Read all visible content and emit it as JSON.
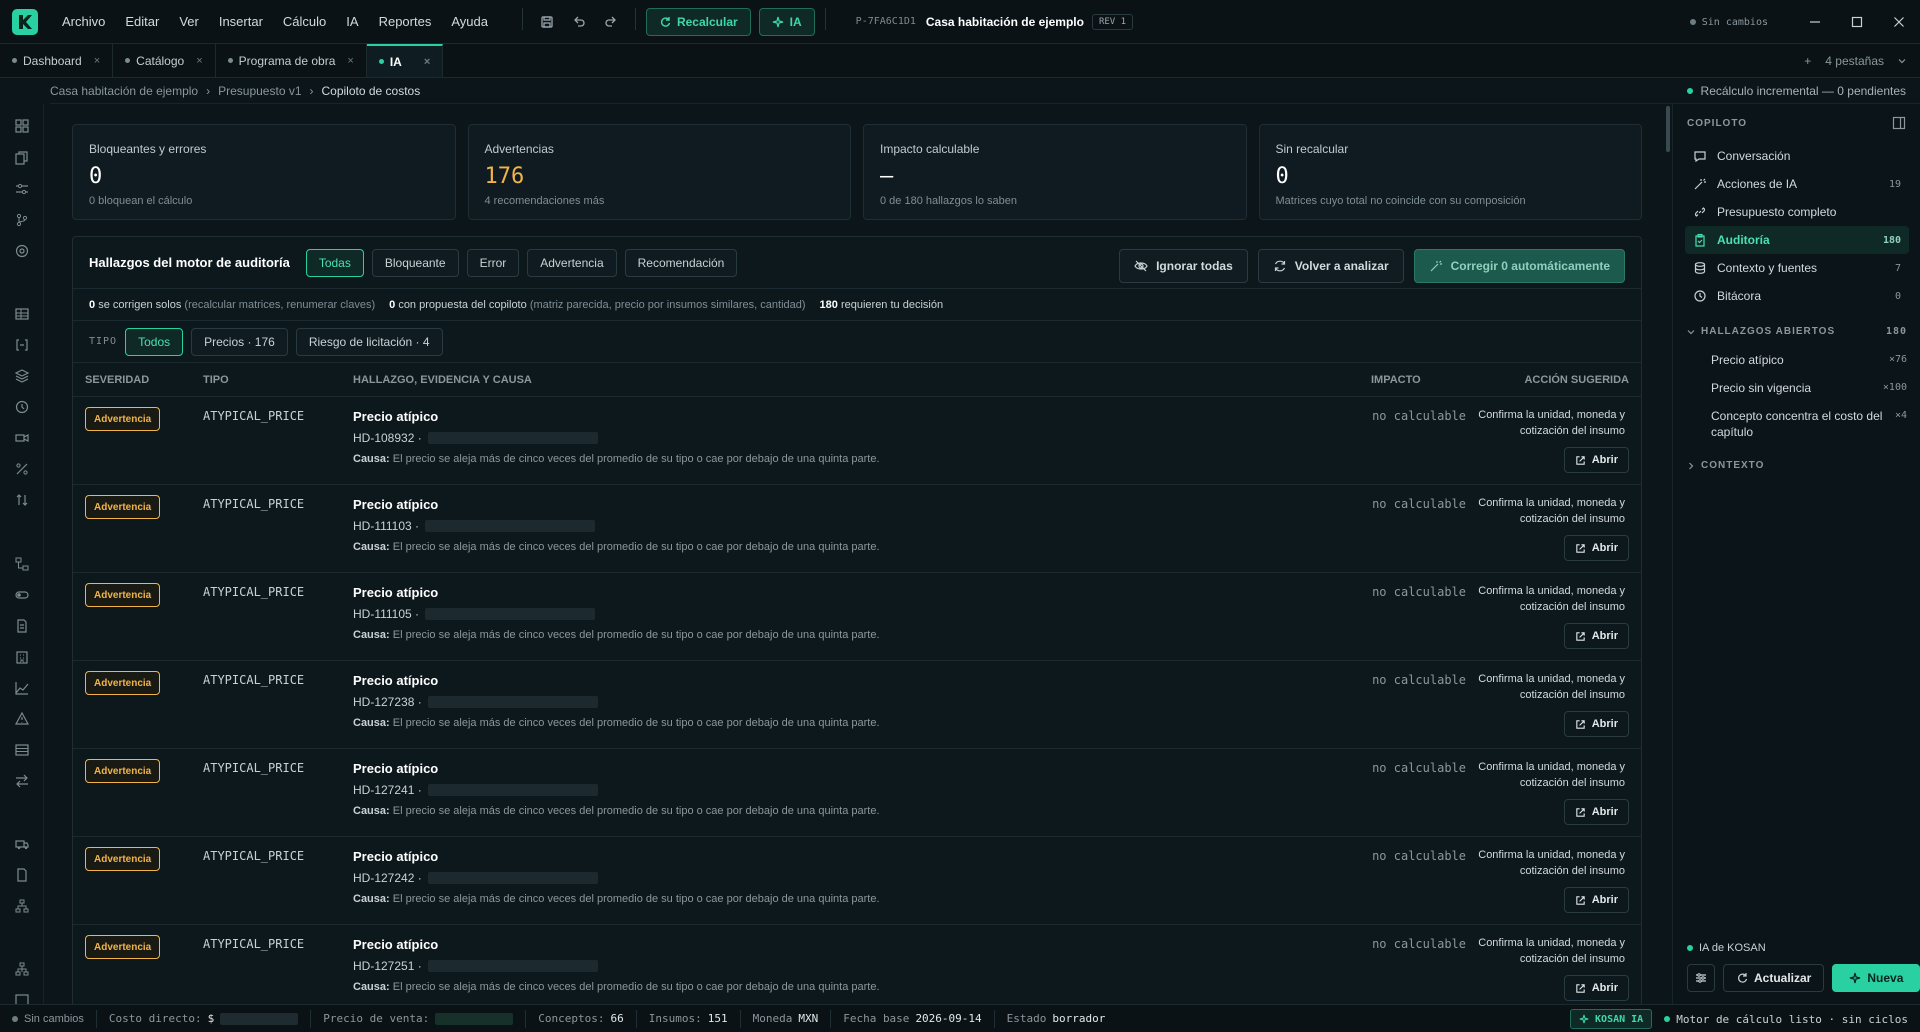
{
  "app": {
    "menu": [
      "Archivo",
      "Editar",
      "Ver",
      "Insertar",
      "Cálculo",
      "IA",
      "Reportes",
      "Ayuda"
    ],
    "recalc_label": "Recalcular",
    "ia_label": "IA",
    "doc_id": "P-7FA6C1D1",
    "doc_title": "Casa habitación de ejemplo",
    "rev": "REV 1",
    "save_state": "Sin cambios"
  },
  "tabs": [
    {
      "label": "Dashboard"
    },
    {
      "label": "Catálogo"
    },
    {
      "label": "Programa de obra"
    },
    {
      "label": "IA"
    }
  ],
  "tabs_count": "4 pestañas",
  "breadcrumb": [
    "Casa habitación de ejemplo",
    "Presupuesto v1",
    "Copiloto de costos"
  ],
  "recalc_status": "Recálculo incremental — 0 pendientes",
  "cards": [
    {
      "label": "Bloqueantes y errores",
      "value": "0",
      "sub": "0 bloquean el cálculo"
    },
    {
      "label": "Advertencias",
      "value": "176",
      "sub": "4 recomendaciones más"
    },
    {
      "label": "Impacto calculable",
      "value": "—",
      "sub": "0 de 180 hallazgos lo saben"
    },
    {
      "label": "Sin recalcular",
      "value": "0",
      "sub": "Matrices cuyo total no coincide con su composición"
    }
  ],
  "findings": {
    "title": "Hallazgos del motor de auditoría",
    "filters": [
      "Todas",
      "Bloqueante",
      "Error",
      "Advertencia",
      "Recomendación"
    ],
    "ignore_label": "Ignorar todas",
    "reanalyze_label": "Volver a analizar",
    "autofix_label": "Corregir 0 automáticamente",
    "summary": {
      "auto_n": "0",
      "auto_txt": "se corrigen solos",
      "auto_note": "(recalcular matrices, renumerar claves)",
      "prop_n": "0",
      "prop_txt": "con propuesta del copiloto",
      "prop_note": "(matriz parecida, precio por insumos similares, cantidad)",
      "dec_n": "180",
      "dec_txt": "requieren tu decisión"
    },
    "type_label": "TIPO",
    "type_filters": [
      "Todos",
      "Precios · 176",
      "Riesgo de licitación · 4"
    ],
    "columns": [
      "SEVERIDAD",
      "TIPO",
      "HALLAZGO, EVIDENCIA Y CAUSA",
      "IMPACTO",
      "ACCIÓN SUGERIDA"
    ],
    "rows": [
      {
        "severity": "Advertencia",
        "type": "ATYPICAL_PRICE",
        "title": "Precio atípico",
        "code": "HD-108932 ·",
        "cause_label": "Causa:",
        "cause": "El precio se aleja más de cinco veces del promedio de su tipo o cae por debajo de una quinta parte.",
        "impact": "no calculable",
        "action": "Confirma la unidad, moneda y cotización del insumo",
        "open": "Abrir"
      },
      {
        "severity": "Advertencia",
        "type": "ATYPICAL_PRICE",
        "title": "Precio atípico",
        "code": "HD-111103 ·",
        "cause_label": "Causa:",
        "cause": "El precio se aleja más de cinco veces del promedio de su tipo o cae por debajo de una quinta parte.",
        "impact": "no calculable",
        "action": "Confirma la unidad, moneda y cotización del insumo",
        "open": "Abrir"
      },
      {
        "severity": "Advertencia",
        "type": "ATYPICAL_PRICE",
        "title": "Precio atípico",
        "code": "HD-111105 ·",
        "cause_label": "Causa:",
        "cause": "El precio se aleja más de cinco veces del promedio de su tipo o cae por debajo de una quinta parte.",
        "impact": "no calculable",
        "action": "Confirma la unidad, moneda y cotización del insumo",
        "open": "Abrir"
      },
      {
        "severity": "Advertencia",
        "type": "ATYPICAL_PRICE",
        "title": "Precio atípico",
        "code": "HD-127238 ·",
        "cause_label": "Causa:",
        "cause": "El precio se aleja más de cinco veces del promedio de su tipo o cae por debajo de una quinta parte.",
        "impact": "no calculable",
        "action": "Confirma la unidad, moneda y cotización del insumo",
        "open": "Abrir"
      },
      {
        "severity": "Advertencia",
        "type": "ATYPICAL_PRICE",
        "title": "Precio atípico",
        "code": "HD-127241 ·",
        "cause_label": "Causa:",
        "cause": "El precio se aleja más de cinco veces del promedio de su tipo o cae por debajo de una quinta parte.",
        "impact": "no calculable",
        "action": "Confirma la unidad, moneda y cotización del insumo",
        "open": "Abrir"
      },
      {
        "severity": "Advertencia",
        "type": "ATYPICAL_PRICE",
        "title": "Precio atípico",
        "code": "HD-127242 ·",
        "cause_label": "Causa:",
        "cause": "El precio se aleja más de cinco veces del promedio de su tipo o cae por debajo de una quinta parte.",
        "impact": "no calculable",
        "action": "Confirma la unidad, moneda y cotización del insumo",
        "open": "Abrir"
      },
      {
        "severity": "Advertencia",
        "type": "ATYPICAL_PRICE",
        "title": "Precio atípico",
        "code": "HD-127251 ·",
        "cause_label": "Causa:",
        "cause": "El precio se aleja más de cinco veces del promedio de su tipo o cae por debajo de una quinta parte.",
        "impact": "no calculable",
        "action": "Confirma la unidad, moneda y cotización del insumo",
        "open": "Abrir"
      }
    ]
  },
  "copilot": {
    "title": "COPILOTO",
    "nav": [
      {
        "label": "Conversación",
        "count": "",
        "icon": "chat-icon"
      },
      {
        "label": "Acciones de IA",
        "count": "19",
        "icon": "wand-icon"
      },
      {
        "label": "Presupuesto completo",
        "count": "",
        "icon": "link-icon"
      },
      {
        "label": "Auditoría",
        "count": "180",
        "icon": "clipboard-icon"
      },
      {
        "label": "Contexto y fuentes",
        "count": "7",
        "icon": "database-icon"
      },
      {
        "label": "Bitácora",
        "count": "0",
        "icon": "history-icon"
      }
    ],
    "open_findings_label": "HALLAZGOS ABIERTOS",
    "open_findings_count": "180",
    "open_findings": [
      {
        "label": "Precio atípico",
        "count": "×76"
      },
      {
        "label": "Precio sin vigencia",
        "count": "×100"
      },
      {
        "label": "Concepto concentra el costo del capítulo",
        "count": "×4"
      }
    ],
    "context_label": "CONTEXTO",
    "ia_label": "IA de KOSAN",
    "refresh_label": "Actualizar",
    "new_label": "Nueva"
  },
  "status": {
    "save_state": "Sin cambios",
    "direct_cost_label": "Costo directo:",
    "direct_cost_prefix": "$",
    "sale_price_label": "Precio de venta:",
    "concepts_label": "Conceptos:",
    "concepts": "66",
    "supplies_label": "Insumos:",
    "supplies": "151",
    "currency_label": "Moneda",
    "currency": "MXN",
    "base_date_label": "Fecha base",
    "base_date": "2026-09-14",
    "state_label": "Estado",
    "state": "borrador",
    "kosan_label": "KOSAN IA",
    "engine_status": "Motor de cálculo listo · sin ciclos"
  },
  "colors": {
    "accent": "#29d1a2",
    "warning": "#f0b44a",
    "background": "#0c1519"
  }
}
